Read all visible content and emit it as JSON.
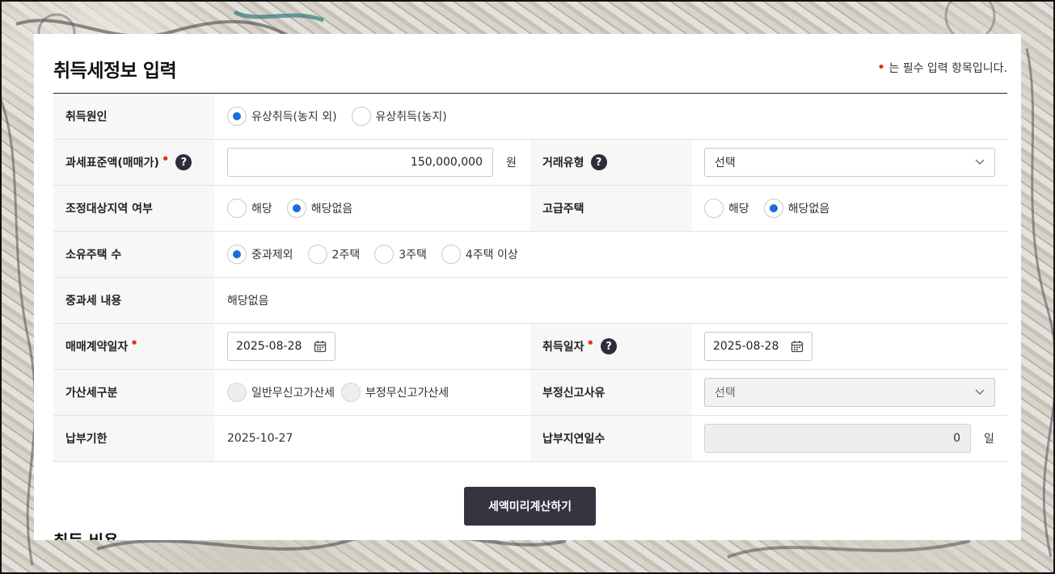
{
  "page": {
    "title": "취득세정보 입력",
    "required_note": "는 필수 입력 항목입니다.",
    "next_section_title": "취득 비용"
  },
  "form": {
    "acquisition_cause": {
      "label": "취득원인",
      "options": [
        "유상취득(농지 외)",
        "유상취득(농지)"
      ],
      "selected": "유상취득(농지 외)"
    },
    "tax_base": {
      "label": "과세표준액(매매가)",
      "value": "150,000,000",
      "unit": "원"
    },
    "transaction_type": {
      "label": "거래유형",
      "selected": "선택"
    },
    "regulated_area": {
      "label": "조정대상지역 여부",
      "options": [
        "해당",
        "해당없음"
      ],
      "selected": "해당없음"
    },
    "luxury_house": {
      "label": "고급주택",
      "options": [
        "해당",
        "해당없음"
      ],
      "selected": "해당없음"
    },
    "houses_owned": {
      "label": "소유주택 수",
      "options": [
        "중과제외",
        "2주택",
        "3주택",
        "4주택 이상"
      ],
      "selected": "중과제외"
    },
    "heavy_tax": {
      "label": "중과세 내용",
      "value": "해당없음"
    },
    "contract_date": {
      "label": "매매계약일자",
      "value": "2025-08-28"
    },
    "acquisition_date": {
      "label": "취득일자",
      "value": "2025-08-28"
    },
    "penalty_type": {
      "label": "가산세구분",
      "options": [
        "일반무신고가산세",
        "부정무신고가산세"
      ],
      "selected": ""
    },
    "fraud_reason": {
      "label": "부정신고사유",
      "selected": "선택"
    },
    "due_date": {
      "label": "납부기한",
      "value": "2025-10-27"
    },
    "delay_days": {
      "label": "납부지연일수",
      "value": "0",
      "unit": "일"
    }
  },
  "actions": {
    "calculate_label": "세액미리계산하기"
  },
  "colors": {
    "accent_radio": "#1a6ed8",
    "required_dot": "#e0361b",
    "button_bg": "#353541"
  }
}
